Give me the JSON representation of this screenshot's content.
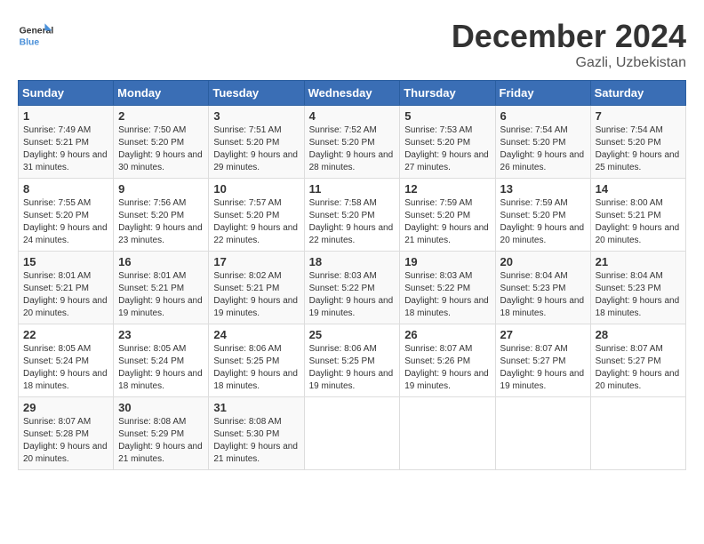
{
  "header": {
    "logo_line1": "General",
    "logo_line2": "Blue",
    "month": "December 2024",
    "location": "Gazli, Uzbekistan"
  },
  "weekdays": [
    "Sunday",
    "Monday",
    "Tuesday",
    "Wednesday",
    "Thursday",
    "Friday",
    "Saturday"
  ],
  "weeks": [
    [
      {
        "day": "1",
        "sunrise": "7:49 AM",
        "sunset": "5:21 PM",
        "daylight": "9 hours and 31 minutes."
      },
      {
        "day": "2",
        "sunrise": "7:50 AM",
        "sunset": "5:20 PM",
        "daylight": "9 hours and 30 minutes."
      },
      {
        "day": "3",
        "sunrise": "7:51 AM",
        "sunset": "5:20 PM",
        "daylight": "9 hours and 29 minutes."
      },
      {
        "day": "4",
        "sunrise": "7:52 AM",
        "sunset": "5:20 PM",
        "daylight": "9 hours and 28 minutes."
      },
      {
        "day": "5",
        "sunrise": "7:53 AM",
        "sunset": "5:20 PM",
        "daylight": "9 hours and 27 minutes."
      },
      {
        "day": "6",
        "sunrise": "7:54 AM",
        "sunset": "5:20 PM",
        "daylight": "9 hours and 26 minutes."
      },
      {
        "day": "7",
        "sunrise": "7:54 AM",
        "sunset": "5:20 PM",
        "daylight": "9 hours and 25 minutes."
      }
    ],
    [
      {
        "day": "8",
        "sunrise": "7:55 AM",
        "sunset": "5:20 PM",
        "daylight": "9 hours and 24 minutes."
      },
      {
        "day": "9",
        "sunrise": "7:56 AM",
        "sunset": "5:20 PM",
        "daylight": "9 hours and 23 minutes."
      },
      {
        "day": "10",
        "sunrise": "7:57 AM",
        "sunset": "5:20 PM",
        "daylight": "9 hours and 22 minutes."
      },
      {
        "day": "11",
        "sunrise": "7:58 AM",
        "sunset": "5:20 PM",
        "daylight": "9 hours and 22 minutes."
      },
      {
        "day": "12",
        "sunrise": "7:59 AM",
        "sunset": "5:20 PM",
        "daylight": "9 hours and 21 minutes."
      },
      {
        "day": "13",
        "sunrise": "7:59 AM",
        "sunset": "5:20 PM",
        "daylight": "9 hours and 20 minutes."
      },
      {
        "day": "14",
        "sunrise": "8:00 AM",
        "sunset": "5:21 PM",
        "daylight": "9 hours and 20 minutes."
      }
    ],
    [
      {
        "day": "15",
        "sunrise": "8:01 AM",
        "sunset": "5:21 PM",
        "daylight": "9 hours and 20 minutes."
      },
      {
        "day": "16",
        "sunrise": "8:01 AM",
        "sunset": "5:21 PM",
        "daylight": "9 hours and 19 minutes."
      },
      {
        "day": "17",
        "sunrise": "8:02 AM",
        "sunset": "5:21 PM",
        "daylight": "9 hours and 19 minutes."
      },
      {
        "day": "18",
        "sunrise": "8:03 AM",
        "sunset": "5:22 PM",
        "daylight": "9 hours and 19 minutes."
      },
      {
        "day": "19",
        "sunrise": "8:03 AM",
        "sunset": "5:22 PM",
        "daylight": "9 hours and 18 minutes."
      },
      {
        "day": "20",
        "sunrise": "8:04 AM",
        "sunset": "5:23 PM",
        "daylight": "9 hours and 18 minutes."
      },
      {
        "day": "21",
        "sunrise": "8:04 AM",
        "sunset": "5:23 PM",
        "daylight": "9 hours and 18 minutes."
      }
    ],
    [
      {
        "day": "22",
        "sunrise": "8:05 AM",
        "sunset": "5:24 PM",
        "daylight": "9 hours and 18 minutes."
      },
      {
        "day": "23",
        "sunrise": "8:05 AM",
        "sunset": "5:24 PM",
        "daylight": "9 hours and 18 minutes."
      },
      {
        "day": "24",
        "sunrise": "8:06 AM",
        "sunset": "5:25 PM",
        "daylight": "9 hours and 18 minutes."
      },
      {
        "day": "25",
        "sunrise": "8:06 AM",
        "sunset": "5:25 PM",
        "daylight": "9 hours and 19 minutes."
      },
      {
        "day": "26",
        "sunrise": "8:07 AM",
        "sunset": "5:26 PM",
        "daylight": "9 hours and 19 minutes."
      },
      {
        "day": "27",
        "sunrise": "8:07 AM",
        "sunset": "5:27 PM",
        "daylight": "9 hours and 19 minutes."
      },
      {
        "day": "28",
        "sunrise": "8:07 AM",
        "sunset": "5:27 PM",
        "daylight": "9 hours and 20 minutes."
      }
    ],
    [
      {
        "day": "29",
        "sunrise": "8:07 AM",
        "sunset": "5:28 PM",
        "daylight": "9 hours and 20 minutes."
      },
      {
        "day": "30",
        "sunrise": "8:08 AM",
        "sunset": "5:29 PM",
        "daylight": "9 hours and 21 minutes."
      },
      {
        "day": "31",
        "sunrise": "8:08 AM",
        "sunset": "5:30 PM",
        "daylight": "9 hours and 21 minutes."
      },
      null,
      null,
      null,
      null
    ]
  ]
}
